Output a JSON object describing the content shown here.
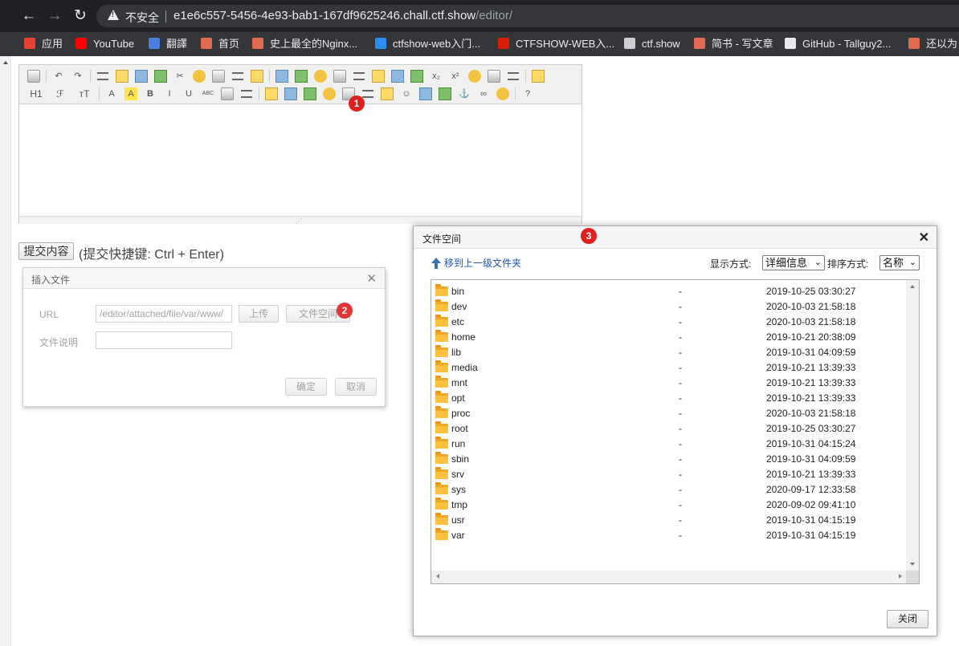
{
  "browser": {
    "nav": {
      "back_icon": "←",
      "forward_icon": "→",
      "reload_icon": "↻"
    },
    "security_label": "不安全",
    "url_host": "e1e6c557-5456-4e93-bab1-167df9625246.chall.ctf.show",
    "url_path": "/editor/",
    "bookmarks": [
      {
        "label": "应用",
        "icon": "apps-grid-icon",
        "color": "#e94235"
      },
      {
        "label": "YouTube",
        "icon": "youtube-icon",
        "color": "#ff0000"
      },
      {
        "label": "翻譯",
        "icon": "translate-icon",
        "color": "#4a7fde"
      },
      {
        "label": "首页",
        "icon": "jianshu-icon",
        "color": "#e06b52"
      },
      {
        "label": "史上最全的Nginx...",
        "icon": "jianshu-icon",
        "color": "#e06b52"
      },
      {
        "label": "ctfshow-web入门...",
        "icon": "cloud-icon",
        "color": "#2d8cf0"
      },
      {
        "label": "CTFSHOW-WEB入...",
        "icon": "csdn-icon",
        "color": "#d81e06"
      },
      {
        "label": "ctf.show",
        "icon": "globe-icon",
        "color": "#cfcfcf"
      },
      {
        "label": "简书 - 写文章",
        "icon": "jianshu-icon",
        "color": "#e06b52"
      },
      {
        "label": "GitHub - Tallguy2...",
        "icon": "github-icon",
        "color": "#e8eaed"
      },
      {
        "label": "还以为",
        "icon": "jianshu-icon",
        "color": "#e06b52"
      }
    ]
  },
  "editor": {
    "toolbar_font_labels": {
      "heading": "H1",
      "font": "ℱ",
      "size": "ᴛT"
    },
    "badge_1": "1"
  },
  "submit": {
    "button": "提交内容",
    "hint": "(提交快捷键: Ctrl + Enter)"
  },
  "insert_dialog": {
    "title": "插入文件",
    "url_label": "URL",
    "url_value": "/editor/attached/file/var/www/",
    "upload_button": "上传",
    "filespace_button": "文件空间",
    "desc_label": "文件说明",
    "ok_button": "确定",
    "cancel_button": "取消",
    "badge_2": "2"
  },
  "file_dialog": {
    "title": "文件空间",
    "badge_3": "3",
    "up_link": "移到上一级文件夹",
    "display_label": "显示方式:",
    "display_value": "详细信息",
    "sort_label": "排序方式:",
    "sort_value": "名称",
    "close_button": "关闭",
    "files": [
      {
        "name": "bin",
        "size": "-",
        "date": "2019-10-25 03:30:27"
      },
      {
        "name": "dev",
        "size": "-",
        "date": "2020-10-03 21:58:18"
      },
      {
        "name": "etc",
        "size": "-",
        "date": "2020-10-03 21:58:18"
      },
      {
        "name": "home",
        "size": "-",
        "date": "2019-10-21 20:38:09"
      },
      {
        "name": "lib",
        "size": "-",
        "date": "2019-10-31 04:09:59"
      },
      {
        "name": "media",
        "size": "-",
        "date": "2019-10-21 13:39:33"
      },
      {
        "name": "mnt",
        "size": "-",
        "date": "2019-10-21 13:39:33"
      },
      {
        "name": "opt",
        "size": "-",
        "date": "2019-10-21 13:39:33"
      },
      {
        "name": "proc",
        "size": "-",
        "date": "2020-10-03 21:58:18"
      },
      {
        "name": "root",
        "size": "-",
        "date": "2019-10-25 03:30:27"
      },
      {
        "name": "run",
        "size": "-",
        "date": "2019-10-31 04:15:24"
      },
      {
        "name": "sbin",
        "size": "-",
        "date": "2019-10-31 04:09:59"
      },
      {
        "name": "srv",
        "size": "-",
        "date": "2019-10-21 13:39:33"
      },
      {
        "name": "sys",
        "size": "-",
        "date": "2020-09-17 12:33:58"
      },
      {
        "name": "tmp",
        "size": "-",
        "date": "2020-09-02 09:41:10"
      },
      {
        "name": "usr",
        "size": "-",
        "date": "2019-10-31 04:15:19"
      },
      {
        "name": "var",
        "size": "-",
        "date": "2019-10-31 04:15:19"
      }
    ]
  }
}
